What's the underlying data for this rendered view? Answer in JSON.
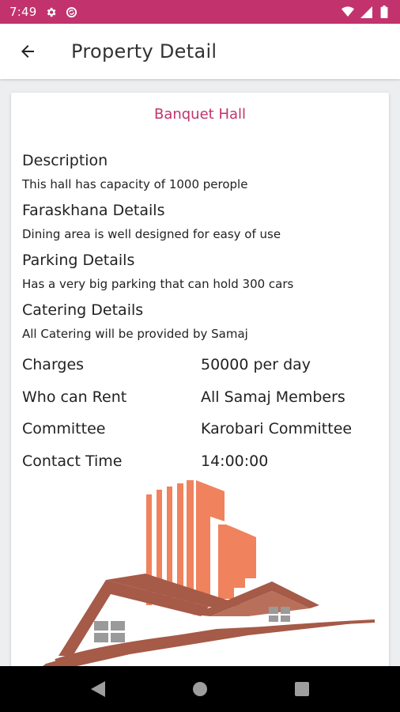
{
  "status_bar": {
    "time": "7:49",
    "icons": [
      "gear-icon",
      "sync-circle-icon",
      "wifi-icon",
      "cellular-icon",
      "battery-icon"
    ]
  },
  "app_bar": {
    "back_icon": "arrow-left-icon",
    "title": "Property Detail"
  },
  "property": {
    "name": "Banquet Hall",
    "sections": [
      {
        "heading": "Description",
        "text": "This hall has capacity of 1000 perople"
      },
      {
        "heading": "Faraskhana Details",
        "text": "Dining area is well designed for easy of use"
      },
      {
        "heading": "Parking Details",
        "text": "Has a very big parking that can hold 300 cars"
      },
      {
        "heading": "Catering Details",
        "text": "All Catering will be provided by Samaj"
      }
    ],
    "details": [
      {
        "label": "Charges",
        "value": "50000 per day"
      },
      {
        "label": "Who can Rent",
        "value": "All Samaj Members"
      },
      {
        "label": "Committee",
        "value": "Karobari Committee"
      },
      {
        "label": "Contact Time",
        "value": "14:00:00"
      }
    ]
  },
  "colors": {
    "accent": "#c2336d",
    "building": "#f0825e",
    "roof": "#a65a48",
    "window": "#9a9a9a"
  },
  "nav_bar": {
    "icons": [
      "back-triangle-icon",
      "home-circle-icon",
      "recents-square-icon"
    ]
  }
}
